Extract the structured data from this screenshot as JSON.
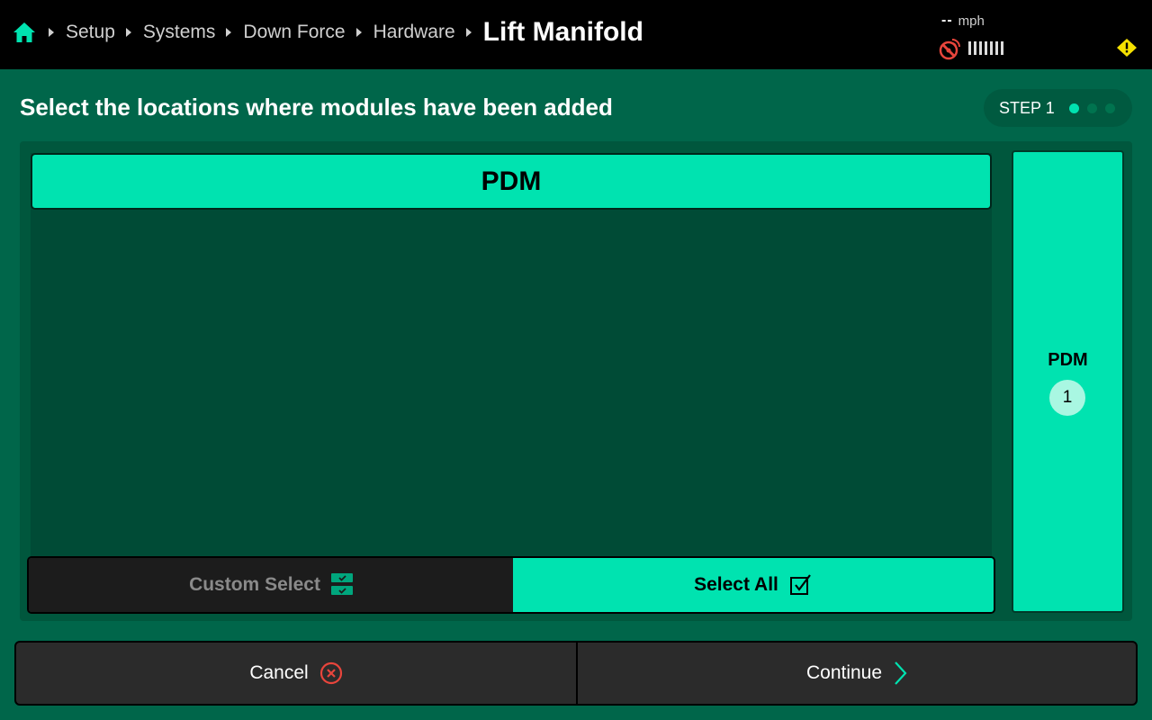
{
  "breadcrumb": {
    "items": [
      "Setup",
      "Systems",
      "Down Force",
      "Hardware"
    ],
    "current": "Lift Manifold"
  },
  "status": {
    "speed_value": "--",
    "speed_unit": "mph",
    "gps_icon": "satellite-dish-icon",
    "warning_icon": "warning-icon"
  },
  "page": {
    "heading": "Select the locations where modules have been added",
    "step_label": "STEP 1",
    "step_total": 3,
    "step_current": 1
  },
  "location": {
    "button_label": "PDM"
  },
  "mode": {
    "custom_label": "Custom Select",
    "all_label": "Select All",
    "selected": "all"
  },
  "side_card": {
    "title": "PDM",
    "count": "1"
  },
  "footer": {
    "cancel_label": "Cancel",
    "continue_label": "Continue"
  },
  "colors": {
    "accent": "#00e3b0",
    "background": "#00664a",
    "danger": "#e8453c",
    "warning": "#f5e100"
  }
}
